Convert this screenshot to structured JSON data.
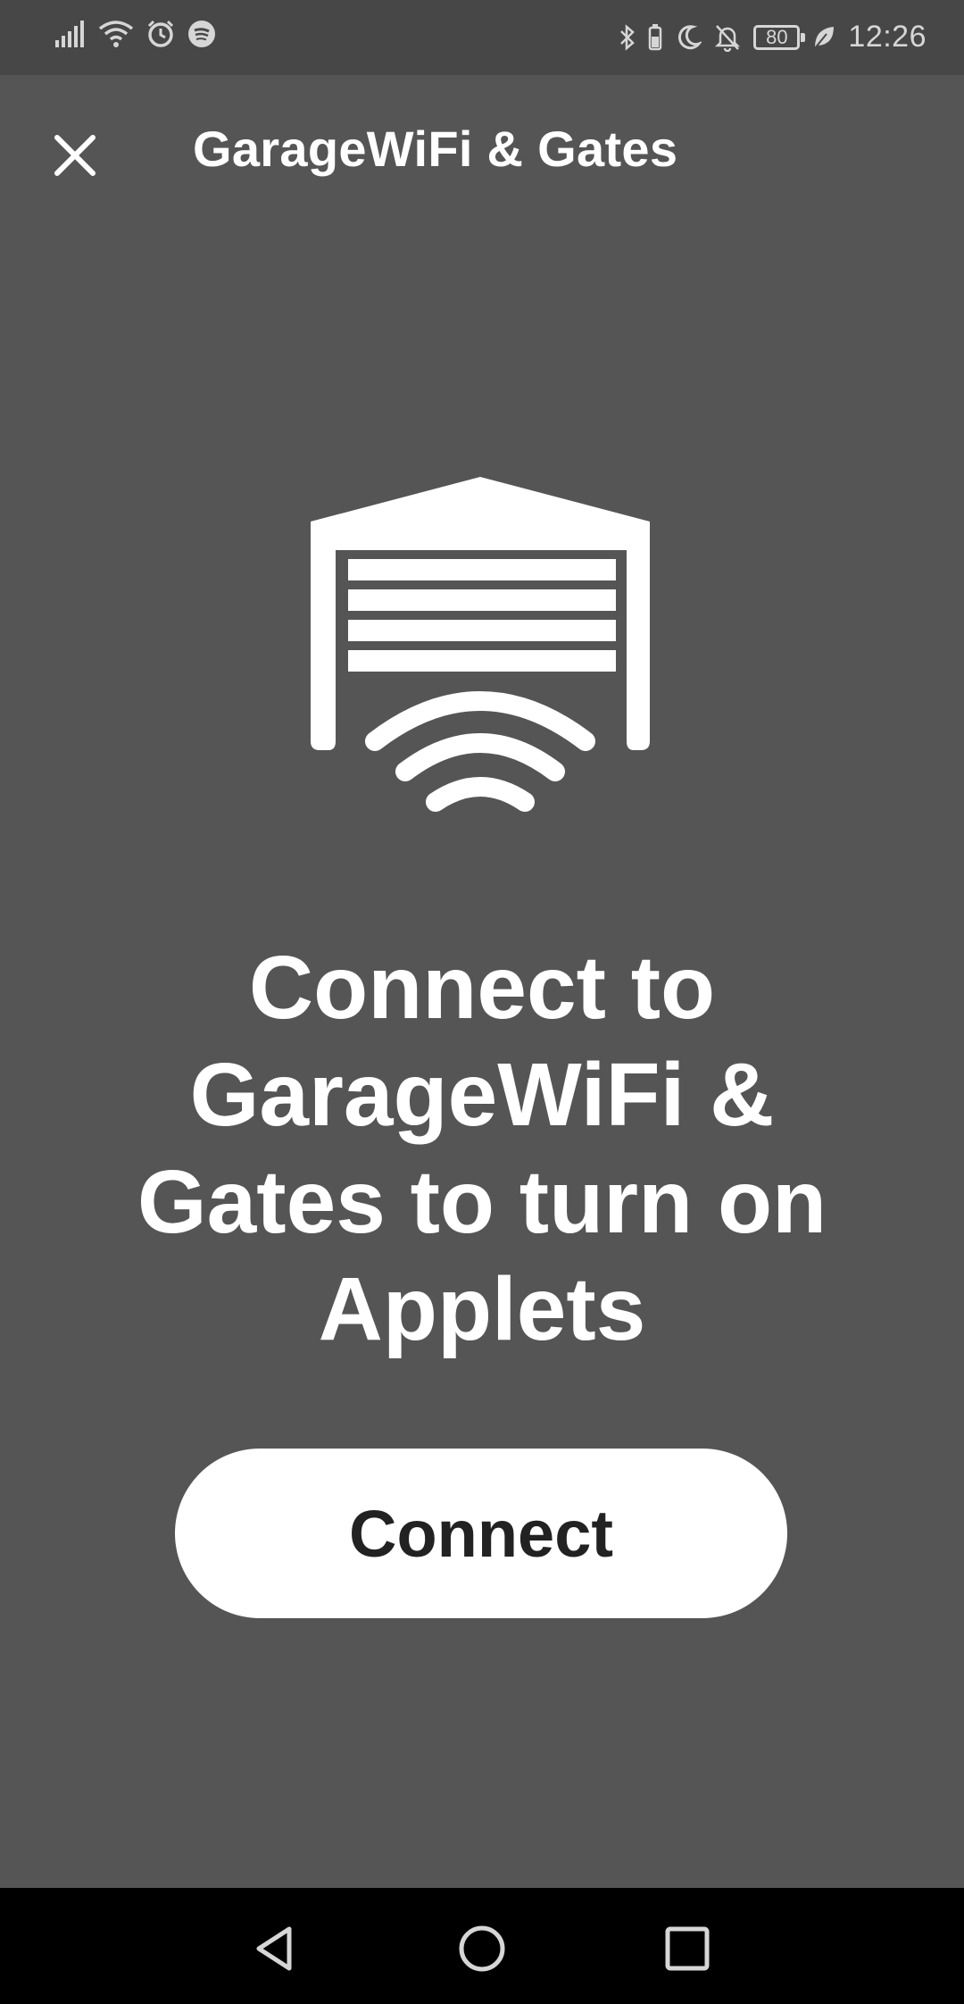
{
  "status_bar": {
    "time": "12:26",
    "battery": "80",
    "icons_left": [
      "signal-icon",
      "wifi-icon",
      "alarm-icon",
      "spotify-icon"
    ],
    "icons_right": [
      "bluetooth-icon",
      "battery-saver-icon",
      "moon-icon",
      "bell-off-icon",
      "battery-icon",
      "leaf-icon"
    ]
  },
  "header": {
    "title": "GarageWiFi & Gates",
    "close_icon": "close-icon"
  },
  "main": {
    "hero_icon": "garage-wifi-icon",
    "headline": "Connect to GarageWiFi & Gates to turn on Applets",
    "connect_label": "Connect"
  },
  "nav_bar": {
    "icons": [
      "back-icon",
      "home-icon",
      "recent-apps-icon"
    ]
  },
  "colors": {
    "background": "#555555",
    "status_bar": "#474747",
    "button_bg": "#ffffff",
    "button_text": "#222222",
    "nav_bar": "#000000"
  }
}
